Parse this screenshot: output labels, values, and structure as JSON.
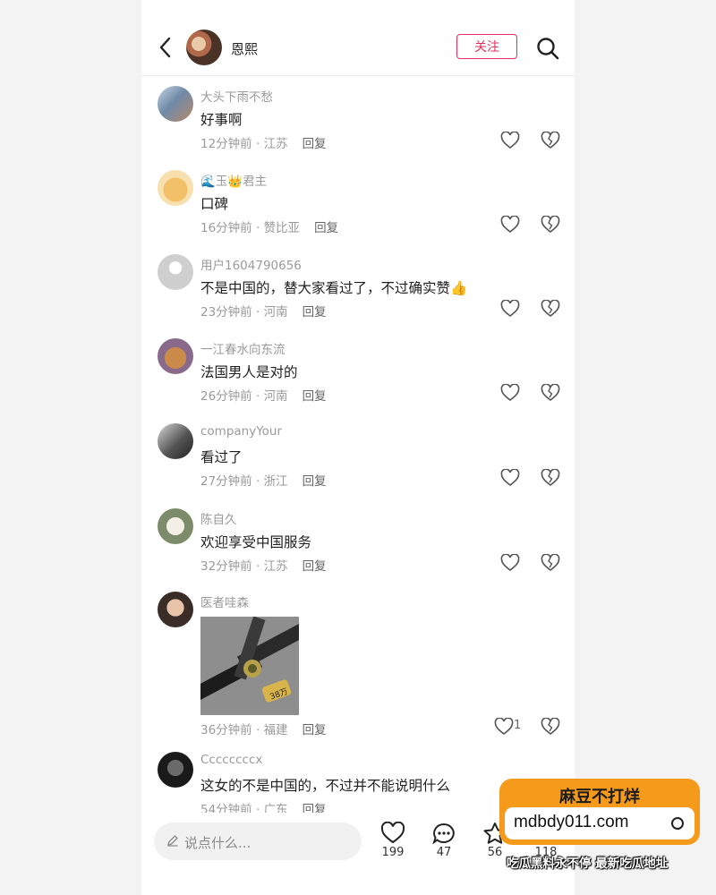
{
  "header": {
    "author_name": "恩熙",
    "follow_label": "关注"
  },
  "comments": [
    {
      "user": "大头下雨不愁",
      "text": "好事啊",
      "time": "12分钟前",
      "location": "江苏",
      "reply": "回复"
    },
    {
      "user": "🌊玉👑君主",
      "text": "口碑",
      "time": "16分钟前",
      "location": "赞比亚",
      "reply": "回复"
    },
    {
      "user": "用户1604790656",
      "text": "不是中国的，替大家看过了，不过确实赞👍",
      "time": "23分钟前",
      "location": "河南",
      "reply": "回复"
    },
    {
      "user": "一江春水向东流",
      "text": "法国男人是对的",
      "time": "26分钟前",
      "location": "河南",
      "reply": "回复"
    },
    {
      "user": "companyYour",
      "text": "看过了",
      "time": "27分钟前",
      "location": "浙江",
      "reply": "回复"
    },
    {
      "user": "陈自久",
      "text": "欢迎享受中国服务",
      "time": "32分钟前",
      "location": "江苏",
      "reply": "回复"
    },
    {
      "user": "医者哇森",
      "text": "",
      "image_labels": [
        "38万"
      ],
      "time": "36分钟前",
      "location": "福建",
      "reply": "回复",
      "likes": "1"
    },
    {
      "user": "Ccccccccx",
      "text": "这女的不是中国的，不过并不能说明什么",
      "time": "54分钟前",
      "location": "广东",
      "reply": "回复"
    }
  ],
  "bottom_bar": {
    "input_placeholder": "说点什么...",
    "likes": "199",
    "comments": "47",
    "favorites": "56",
    "shares": "118"
  },
  "ad": {
    "title": "麻豆不打烊",
    "url": "mdbdy011.com",
    "caption": "吃瓜黑料永不停  最新吃瓜地址"
  },
  "colors": {
    "accent": "#e0315c",
    "ad_orange": "#f59a1a"
  }
}
